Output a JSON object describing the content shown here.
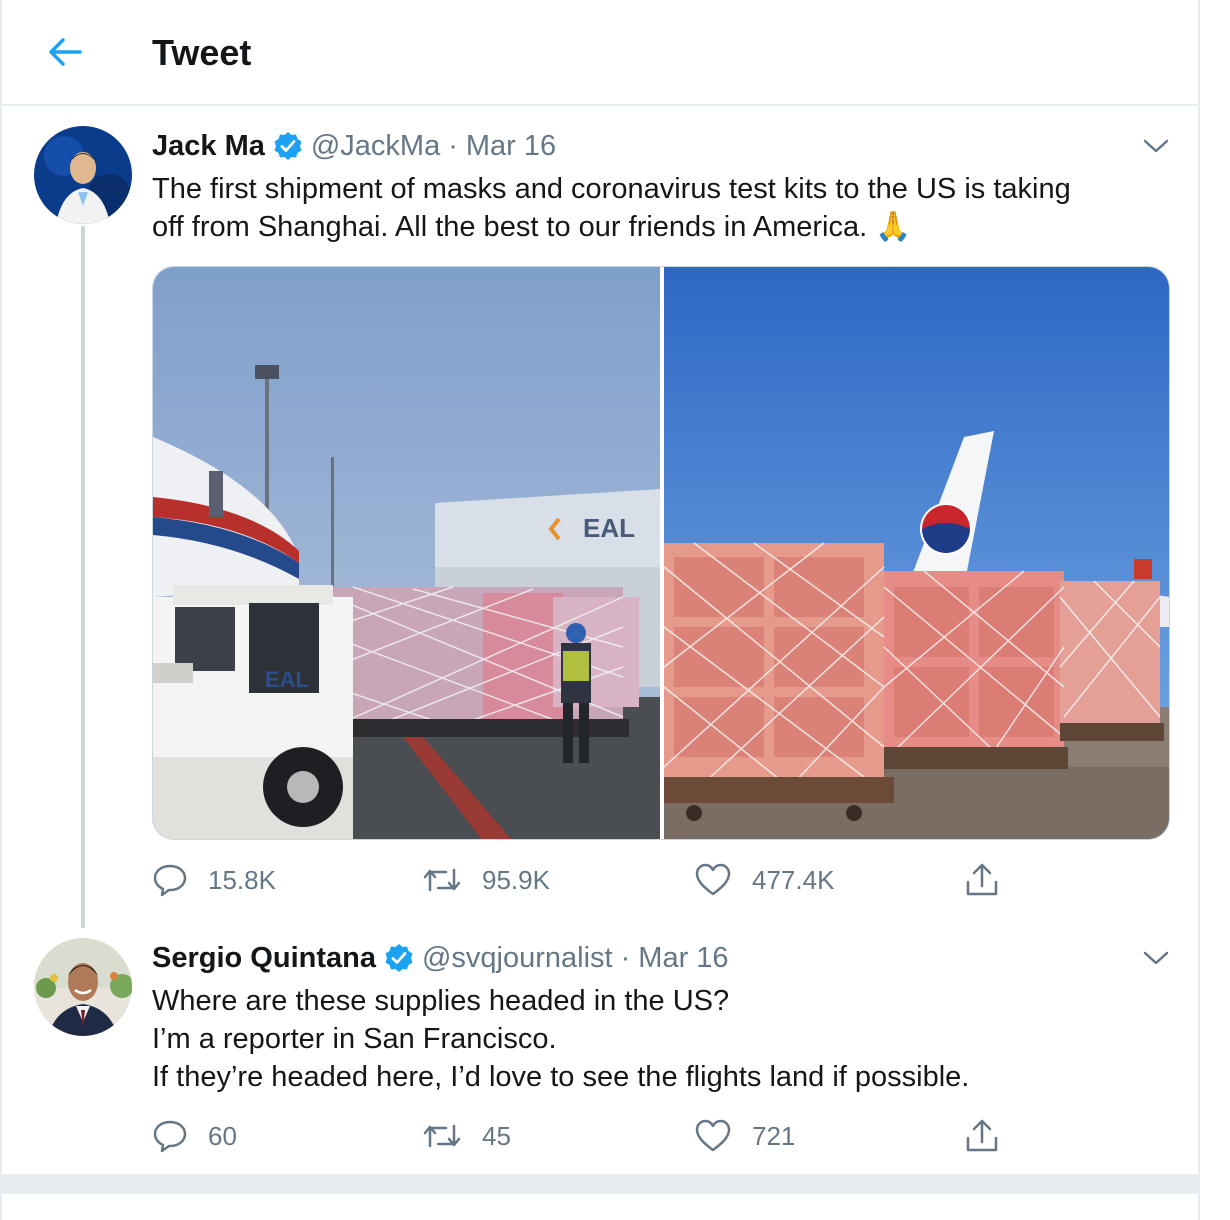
{
  "header": {
    "title": "Tweet",
    "back_icon": "arrow-left-icon"
  },
  "colors": {
    "accent": "#1da1f2",
    "text": "#14171a",
    "secondary": "#657786",
    "border": "#e6ecf0"
  },
  "tweet": {
    "name": "Jack Ma",
    "handle": "@JackMa",
    "separator": "·",
    "date": "Mar 16",
    "text_lines": [
      "The first shipment of masks and coronavirus test kits to the US is taking",
      "off from Shanghai. All the best to our friends in America. 🙏"
    ],
    "media": [
      {
        "name": "cargo-loading-photo",
        "sign_text": "EAL",
        "truck_text": "EAL"
      },
      {
        "name": "cargo-pallets-photo"
      }
    ],
    "stats": {
      "replies": "15.8K",
      "retweets": "95.9K",
      "likes": "477.4K"
    }
  },
  "reply": {
    "name": "Sergio Quintana",
    "handle": "@svqjournalist",
    "separator": "·",
    "date": "Mar 16",
    "text_lines": [
      "Where are these supplies headed in the US?",
      "I’m a reporter in San Francisco.",
      "If they’re headed here, I’d love to see the flights land if possible."
    ],
    "stats": {
      "replies": "60",
      "retweets": "45",
      "likes": "721"
    }
  }
}
